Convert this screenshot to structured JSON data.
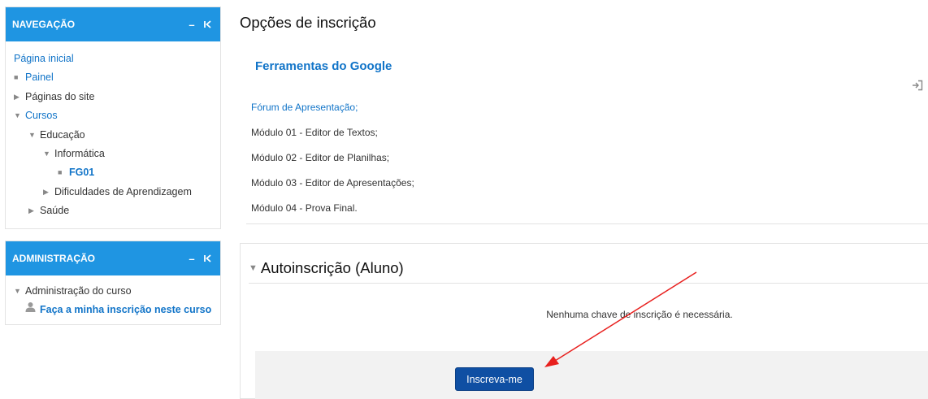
{
  "nav_block": {
    "title": "NAVEGAÇÃO",
    "ctrl_minimize": "–",
    "ctrl_dock": "K",
    "items": [
      {
        "label": "Página inicial"
      },
      {
        "label": "Painel"
      },
      {
        "label": "Páginas do site"
      },
      {
        "label": "Cursos"
      },
      {
        "label": "Educação"
      },
      {
        "label": "Informática"
      },
      {
        "label": "FG01"
      },
      {
        "label": "Dificuldades de Aprendizagem"
      },
      {
        "label": "Saúde"
      }
    ]
  },
  "admin_block": {
    "title": "ADMINISTRAÇÃO",
    "ctrl_minimize": "–",
    "ctrl_dock": "K",
    "items": [
      {
        "label": "Administração do curso"
      },
      {
        "label": "Faça a minha inscrição neste curso"
      }
    ]
  },
  "main": {
    "page_title": "Opções de inscrição",
    "course_name": "Ferramentas do Google",
    "modules": [
      "Fórum de Apresentação;",
      "Módulo 01 - Editor de Textos;",
      "Módulo 02 - Editor de Planilhas;",
      "Módulo 03 - Editor de Apresentações;",
      "Módulo 04 - Prova Final."
    ],
    "enrol": {
      "title": "Autoinscrição (Aluno)",
      "message": "Nenhuma chave de inscrição é necessária.",
      "button_label": "Inscreva-me"
    }
  },
  "colors": {
    "header_blue": "#1f95e2",
    "link_blue": "#1174c8",
    "button_blue": "#0f4fa3",
    "annotation_red": "#e8201e"
  }
}
